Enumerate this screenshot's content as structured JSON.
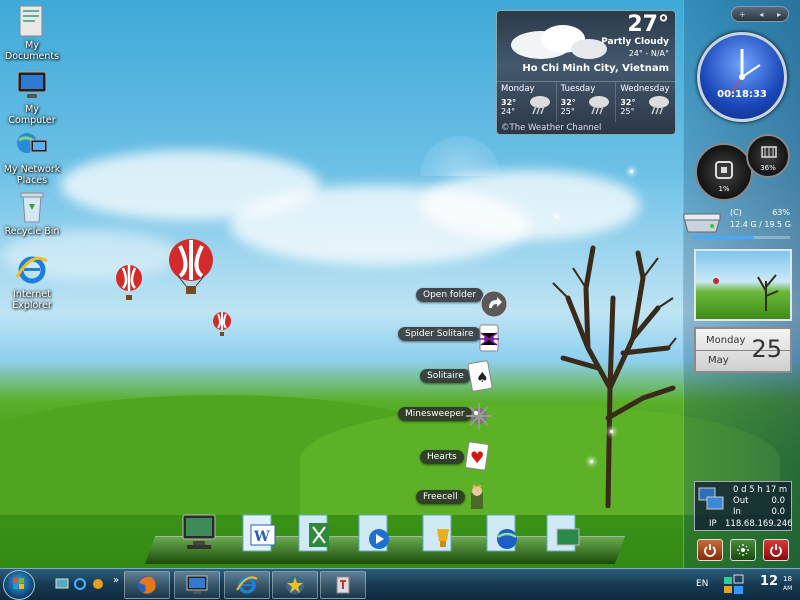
{
  "desktop": {
    "icons": [
      {
        "label": "My Documents",
        "icon": "folder-icon"
      },
      {
        "label": "My Computer",
        "icon": "computer-icon"
      },
      {
        "label": "My Network Places",
        "icon": "network-icon"
      },
      {
        "label": "Recycle Bin",
        "icon": "recycle-bin-icon"
      },
      {
        "label": "Internet Explorer",
        "icon": "internet-explorer-icon"
      }
    ]
  },
  "stack_menu": {
    "items": [
      {
        "label": "Open folder",
        "icon": "arrow-icon"
      },
      {
        "label": "Spider Solitaire",
        "icon": "spider-icon"
      },
      {
        "label": "Solitaire",
        "icon": "card-icon"
      },
      {
        "label": "Minesweeper",
        "icon": "mine-icon"
      },
      {
        "label": "Hearts",
        "icon": "heart-card-icon"
      },
      {
        "label": "Freecell",
        "icon": "freecell-king-icon"
      }
    ]
  },
  "weather": {
    "temperature": "27°",
    "condition": "Partly Cloudy",
    "high_low": "24° - N/A°",
    "city": "Ho Chi Minh City, Vietnam",
    "forecast": [
      {
        "day": "Monday",
        "high": "32°",
        "low": "24°"
      },
      {
        "day": "Tuesday",
        "high": "32°",
        "low": "25°"
      },
      {
        "day": "Wednesday",
        "high": "32°",
        "low": "25°"
      }
    ],
    "credit": "©The Weather Channel"
  },
  "sidebar": {
    "controls": [
      "+",
      "◂",
      "▸"
    ],
    "clock_time": "00:18:33",
    "cpu_meter": "1%",
    "ram_meter": "36%",
    "drive": {
      "name": "(C)",
      "percent": "63%",
      "percent_value": 63,
      "usage": "12.4 G / 19.5 G"
    },
    "calendar": {
      "weekday": "Monday",
      "month": "May",
      "day": "25"
    },
    "network": {
      "uptime": "0 d 5 h 17 m",
      "out_label": "Out",
      "out_value": "0.0",
      "in_label": "In",
      "in_value": "0.0",
      "ip_label": "IP",
      "ip_value": "118.68.169.246"
    }
  },
  "taskbar": {
    "language": "EN",
    "time": "12",
    "time_minutes": "18",
    "ampm": "AM",
    "quicklaunch_more": "»"
  },
  "colors": {
    "sky_top": "#3fa9d8",
    "grass": "#3f9a1a",
    "taskbar": "#163a52",
    "accent_blue": "#1b47b8"
  }
}
